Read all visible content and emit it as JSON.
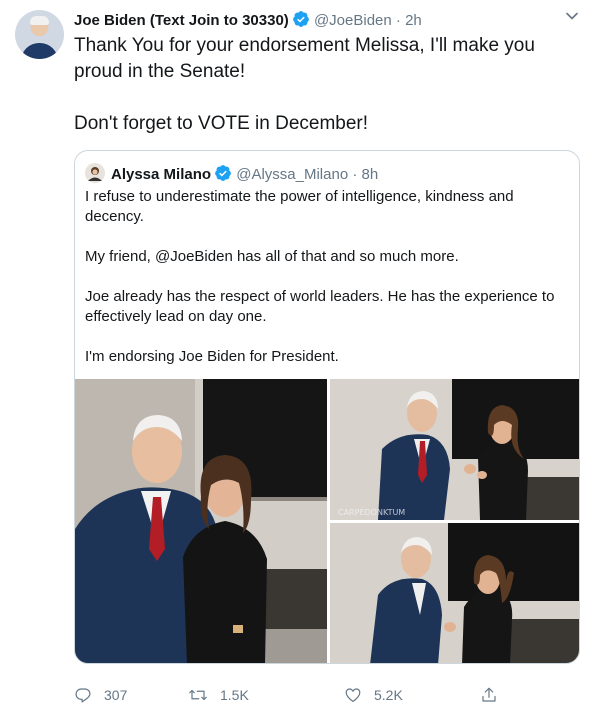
{
  "tweet": {
    "author_name": "Joe Biden (Text Join to 30330)",
    "handle": "@JoeBiden",
    "separator": "·",
    "time": "2h",
    "text_line1": "Thank You for your endorsement Melissa, I'll make you proud in the Senate!",
    "text_line2": "Don't forget to VOTE in December!"
  },
  "quote": {
    "author_name": "Alyssa Milano",
    "handle": "@Alyssa_Milano",
    "separator": "·",
    "time": "8h",
    "paragraphs": [
      "I refuse to underestimate the power of intelligence, kindness and decency.",
      "My friend, @JoeBiden has all of that and so much more.",
      "Joe already has the respect of world leaders. He has the experience to effectively lead on day one.",
      "I'm endorsing Joe Biden for President."
    ],
    "watermark": "CARPEDONKTUM"
  },
  "actions": {
    "reply_count": "307",
    "retweet_count": "1.5K",
    "like_count": "5.2K"
  },
  "icons": {
    "verified": "verified-badge-icon",
    "caret": "chevron-down-icon",
    "reply": "reply-icon",
    "retweet": "retweet-icon",
    "like": "heart-icon",
    "share": "share-icon"
  },
  "colors": {
    "accent": "#1da1f2",
    "text": "#14171a",
    "muted": "#657786",
    "border": "#ccd6dd"
  }
}
